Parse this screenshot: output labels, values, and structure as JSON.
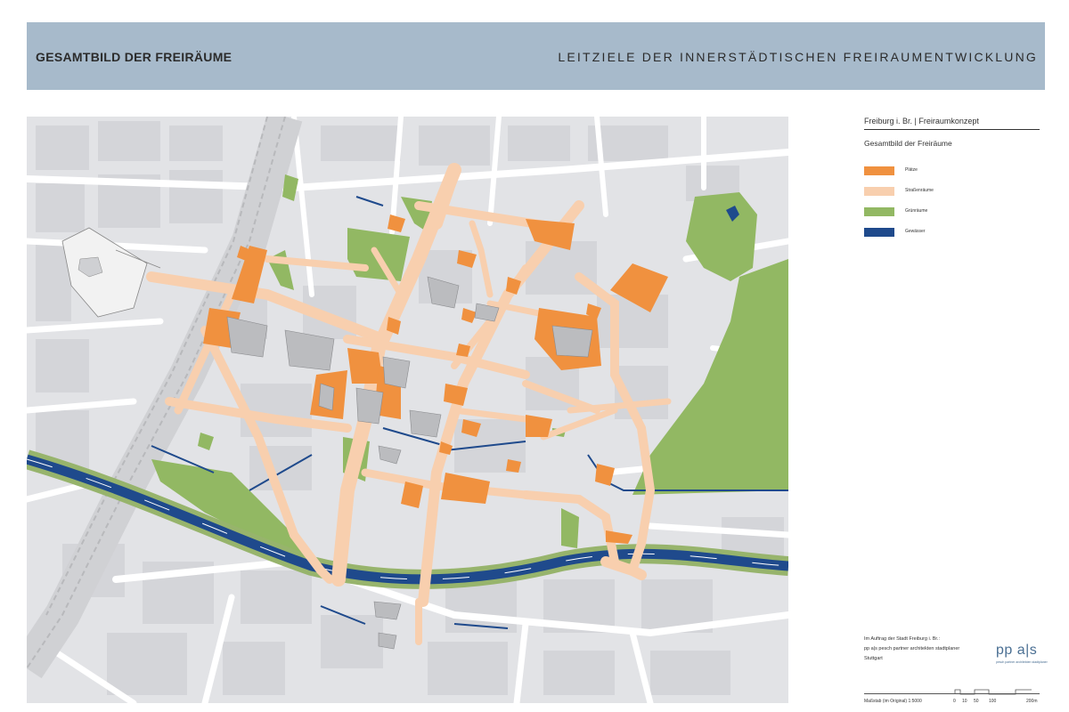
{
  "header": {
    "left_title": "GESAMTBILD DER FREIRÄUME",
    "right_title": "LEITZIELE DER INNERSTÄDTISCHEN FREIRAUMENTWICKLUNG"
  },
  "legend": {
    "title": "Freiburg i. Br. | Freiraumkonzept",
    "subtitle": "Gesamtbild der Freiräume",
    "items": [
      {
        "label": "Plätze",
        "color": "#f0913f"
      },
      {
        "label": "Straßenräume",
        "color": "#f8cfae"
      },
      {
        "label": "Grünräume",
        "color": "#92b863"
      },
      {
        "label": "Gewässer",
        "color": "#1f4a8c"
      }
    ]
  },
  "credits": {
    "line1": "Im Auftrag der Stadt Freiburg i. Br.:",
    "line2": "pp a|s pesch partner architekten stadtplaner",
    "line3": "Stuttgart"
  },
  "logo": {
    "text": "pp a|s",
    "subtext": "pesch partner architekten stadtplaner"
  },
  "scale": {
    "label": "Maßstab (im Original) 1:5000",
    "ticks": [
      "0",
      "10",
      "50",
      "100",
      "200m"
    ]
  },
  "colors": {
    "header_band": "#a7bacb",
    "map_background": "#e2e3e6",
    "roads": "#ffffff",
    "buildings_bg": "#d3d4d8",
    "railway": "#c9cacd"
  }
}
